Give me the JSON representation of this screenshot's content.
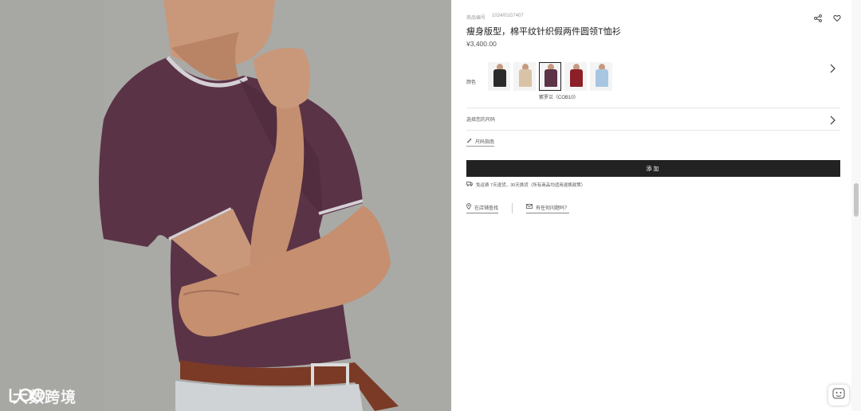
{
  "product": {
    "reference_label": "商品编号",
    "reference_code": "1024/01G7407",
    "title": "瘦身版型，棉平纹针织假两件圆领T恤衫",
    "price": "¥3,400.00"
  },
  "color": {
    "label": "颜色",
    "selected_caption": "紫罗兰（COB10）",
    "swatches": [
      {
        "name": "black",
        "color": "#2b2b2b"
      },
      {
        "name": "beige",
        "color": "#d9c3a7"
      },
      {
        "name": "plum",
        "color": "#5c3347"
      },
      {
        "name": "red",
        "color": "#8c1f28"
      },
      {
        "name": "light-blue",
        "color": "#a9c6e0"
      }
    ],
    "selected_index": 2
  },
  "size": {
    "label": "选择您的尺码",
    "guide_label": "尺码指南"
  },
  "actions": {
    "add_label": "添加",
    "shipping_note": "免运费  7天退货，30天换货（所有商品均适用退换政策）",
    "link_store": "在店铺查找",
    "link_contact": "有任何问题吗？"
  },
  "watermark": {
    "text": "大数跨境"
  },
  "colors": {
    "button_bg": "#222222",
    "shirt_main": "#5b3346"
  }
}
